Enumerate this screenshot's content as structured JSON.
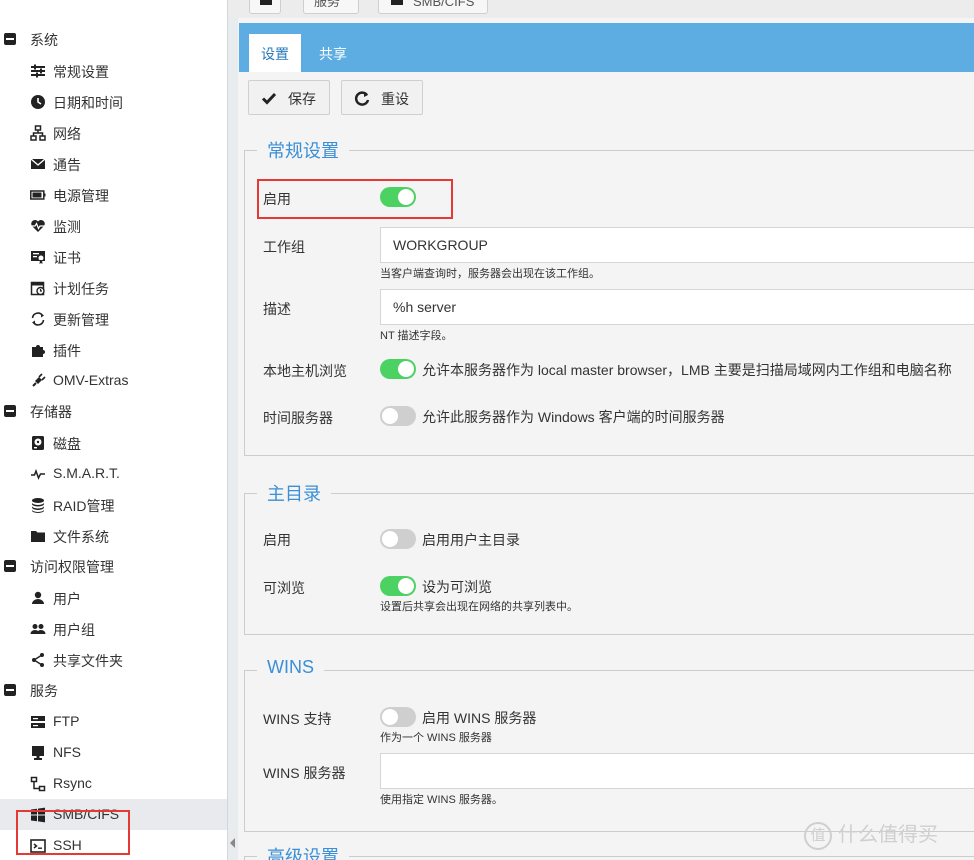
{
  "breadcrumb": {
    "service": "服务",
    "smb": "SMB/CIFS"
  },
  "sidebar": {
    "groups": [
      {
        "label": "系统"
      },
      {
        "label": "存储器"
      },
      {
        "label": "访问权限管理"
      },
      {
        "label": "服务"
      }
    ],
    "items": [
      {
        "label": "常规设置",
        "icon": "sliders-icon"
      },
      {
        "label": "日期和时间",
        "icon": "clock-icon"
      },
      {
        "label": "网络",
        "icon": "network-icon"
      },
      {
        "label": "通告",
        "icon": "envelope-icon"
      },
      {
        "label": "电源管理",
        "icon": "battery-icon"
      },
      {
        "label": "监测",
        "icon": "heartbeat-icon"
      },
      {
        "label": "证书",
        "icon": "certificate-icon"
      },
      {
        "label": "计划任务",
        "icon": "calendar-clock-icon"
      },
      {
        "label": "更新管理",
        "icon": "refresh-icon"
      },
      {
        "label": "插件",
        "icon": "puzzle-icon"
      },
      {
        "label": "OMV-Extras",
        "icon": "plug-icon"
      },
      {
        "label": "磁盘",
        "icon": "hdd-icon"
      },
      {
        "label": "S.M.A.R.T.",
        "icon": "pulse-icon"
      },
      {
        "label": "RAID管理",
        "icon": "database-icon"
      },
      {
        "label": "文件系统",
        "icon": "folder-icon"
      },
      {
        "label": "用户",
        "icon": "user-icon"
      },
      {
        "label": "用户组",
        "icon": "users-icon"
      },
      {
        "label": "共享文件夹",
        "icon": "share-icon"
      },
      {
        "label": "FTP",
        "icon": "server-icon"
      },
      {
        "label": "NFS",
        "icon": "desktop-icon"
      },
      {
        "label": "Rsync",
        "icon": "sitemap-icon"
      },
      {
        "label": "SMB/CIFS",
        "icon": "windows-icon"
      },
      {
        "label": "SSH",
        "icon": "terminal-icon"
      }
    ],
    "active_item": "SMB/CIFS"
  },
  "tabs": {
    "settings": "设置",
    "share": "共享"
  },
  "toolbar": {
    "save": "保存",
    "reset": "重设"
  },
  "general": {
    "legend": "常规设置",
    "enable_label": "启用",
    "enable_on": true,
    "workgroup_label": "工作组",
    "workgroup_value": "WORKGROUP",
    "workgroup_hint": "当客户端查询时，服务器会出现在该工作组。",
    "description_label": "描述",
    "description_value": "%h server",
    "description_hint": "NT 描述字段。",
    "local_browse_label": "本地主机浏览",
    "local_browse_text": "允许本服务器作为 local master browser，LMB 主要是扫描局域网内工作组和电脑名称",
    "local_browse_on": true,
    "time_server_label": "时间服务器",
    "time_server_text": "允许此服务器作为 Windows 客户端的时间服务器",
    "time_server_on": false
  },
  "home": {
    "legend": "主目录",
    "enable_label": "启用",
    "enable_text": "启用用户主目录",
    "enable_on": false,
    "browsable_label": "可浏览",
    "browsable_text": "设为可浏览",
    "browsable_on": true,
    "browsable_hint": "设置后共享会出现在网络的共享列表中。"
  },
  "wins": {
    "legend": "WINS",
    "support_label": "WINS 支持",
    "support_text": "启用 WINS 服务器",
    "support_on": false,
    "support_hint": "作为一个 WINS 服务器",
    "server_label": "WINS 服务器",
    "server_value": "",
    "server_hint": "使用指定 WINS 服务器。"
  },
  "advanced": {
    "legend": "高级设置"
  },
  "watermark": {
    "badge": "值",
    "text": "什么值得买"
  }
}
